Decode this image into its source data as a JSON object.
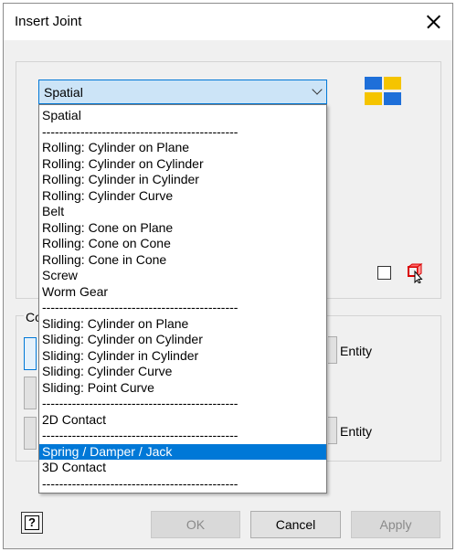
{
  "window": {
    "title": "Insert Joint"
  },
  "combo": {
    "value": "Spatial"
  },
  "dropdown": {
    "items": [
      "Spatial",
      "----------------------------------------------",
      "Rolling: Cylinder on Plane",
      "Rolling: Cylinder on Cylinder",
      "Rolling: Cylinder in Cylinder",
      "Rolling: Cylinder Curve",
      "Belt",
      "Rolling: Cone on Plane",
      "Rolling: Cone on Cone",
      "Rolling: Cone in Cone",
      "Screw",
      "Worm Gear",
      "----------------------------------------------",
      "Sliding: Cylinder on Plane",
      "Sliding: Cylinder on Cylinder",
      "Sliding: Cylinder in Cylinder",
      "Sliding: Cylinder Curve",
      "Sliding: Point Curve",
      "----------------------------------------------",
      "2D Contact",
      "----------------------------------------------",
      "Spring / Damper / Jack",
      "3D Contact",
      "----------------------------------------------"
    ],
    "selected_index": 21
  },
  "group": {
    "label": "Co"
  },
  "entity": {
    "label_1": "Entity",
    "label_2": "Entity"
  },
  "help": {
    "glyph": "?"
  },
  "buttons": {
    "ok": "OK",
    "cancel": "Cancel",
    "apply": "Apply"
  },
  "colors": {
    "accent": "#0078d7",
    "selection": "#0078d7",
    "icon_blue": "#1e6fd9",
    "icon_yellow": "#f5c400",
    "cube_red": "#d90000"
  },
  "icons": {
    "joint_type": "joint-grid-icon",
    "cube": "cube-select-icon",
    "close": "close-icon"
  }
}
